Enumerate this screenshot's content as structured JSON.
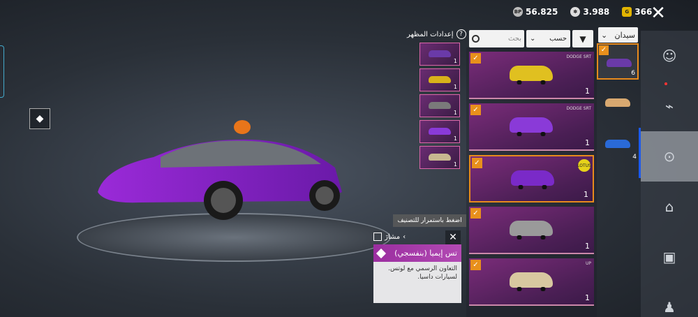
{
  "currency": {
    "bp": {
      "icon": "bp-coin-icon",
      "label": "BP",
      "value": "56.825"
    },
    "uc": {
      "icon": "uc-coin-icon",
      "value": "3.988"
    },
    "ag": {
      "icon": "ag-coin-icon",
      "label": "G",
      "value": "366"
    }
  },
  "appearance": {
    "label": "إعدادات المظهر",
    "help": "?"
  },
  "filters": {
    "search_placeholder": "بحث",
    "sort_label": "حسب",
    "category": "سيدان"
  },
  "thumbs": [
    {
      "color": "#6a3aa8",
      "count": "1"
    },
    {
      "color": "#d8b21a",
      "count": "1"
    },
    {
      "color": "#7a7a7a",
      "count": "1"
    },
    {
      "color": "#8a3ad8",
      "count": "1"
    },
    {
      "color": "#c8b890",
      "count": "1"
    }
  ],
  "cards": [
    {
      "brand": "DODGE SRT",
      "color": "#e0c020",
      "count": "1",
      "selected": false
    },
    {
      "brand": "DODGE SRT",
      "color": "#8a3ad8",
      "count": "1",
      "selected": false
    },
    {
      "brand": "LOTUS",
      "color": "#7a2ac8",
      "count": "1",
      "selected": true
    },
    {
      "brand": "",
      "color": "#9a9a9a",
      "count": "1",
      "selected": false
    },
    {
      "brand": "UP",
      "color": "#d8c8a0",
      "count": "1",
      "selected": false
    }
  ],
  "mini": [
    {
      "color": "#6a3aa8",
      "count": "6",
      "selected": true
    },
    {
      "color": "#d8a870",
      "count": "",
      "selected": false
    },
    {
      "color": "#2a6ad8",
      "count": "4",
      "selected": false
    }
  ],
  "nav": [
    {
      "icon": "character-icon"
    },
    {
      "icon": "gun-icon"
    },
    {
      "icon": "steering-wheel-icon"
    },
    {
      "icon": "building-icon"
    },
    {
      "icon": "box-icon"
    },
    {
      "icon": "soldier-icon"
    }
  ],
  "hint": "اضغط باستمرار للتصنيف",
  "share_label": "مشارَ",
  "info": {
    "title": "تس إيميا (بنفسجي)",
    "description": "التعاون الرسمي مع لوتس. لسيارات داسيا."
  }
}
